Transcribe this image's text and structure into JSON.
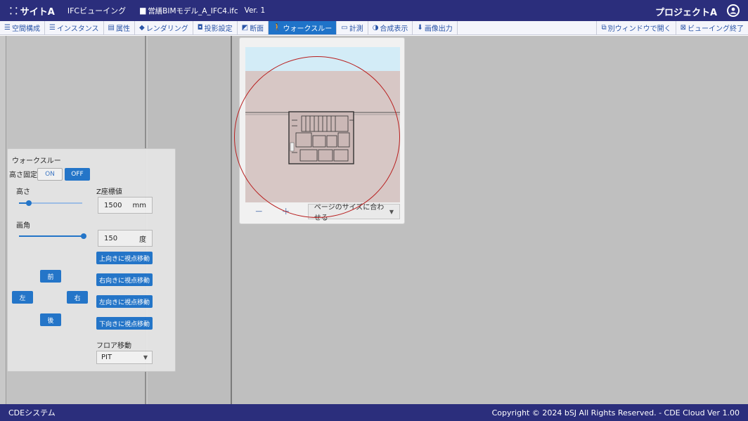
{
  "titlebar": {
    "site_label": "サイトA",
    "viewer_label": "IFCビューイング",
    "file_name": "営繕BIMモデル_A_IFC4.ifc",
    "version": "Ver. 1",
    "project": "プロジェクトA"
  },
  "toolbar": {
    "items": [
      {
        "icon": "list-icon",
        "glyph": "☰",
        "label": "空間構成"
      },
      {
        "icon": "list-icon",
        "glyph": "☰",
        "label": "インスタンス"
      },
      {
        "icon": "table-icon",
        "glyph": "▤",
        "label": "属性"
      },
      {
        "icon": "rendering-icon",
        "glyph": "◆",
        "label": "レンダリング"
      },
      {
        "icon": "camera-icon",
        "glyph": "◘",
        "label": "投影設定"
      },
      {
        "icon": "section-icon",
        "glyph": "◩",
        "label": "断面"
      },
      {
        "icon": "walk-icon",
        "glyph": "🚶",
        "label": "ウォークスルー",
        "active": true
      },
      {
        "icon": "measure-icon",
        "glyph": "▭",
        "label": "計測"
      },
      {
        "icon": "composite-icon",
        "glyph": "◑",
        "label": "合成表示"
      },
      {
        "icon": "download-icon",
        "glyph": "⬇",
        "label": "画像出力"
      }
    ],
    "right": [
      {
        "icon": "open-window-icon",
        "glyph": "⧉",
        "label": "別ウィンドウで開く"
      },
      {
        "icon": "close-view-icon",
        "glyph": "⊠",
        "label": "ビューイング終了"
      }
    ]
  },
  "walkthrough": {
    "title": "ウォークスルー",
    "height_fix_label": "高さ固定",
    "on_label": "ON",
    "off_label": "OFF",
    "height_label": "高さ",
    "z_label": "Z座標値",
    "z_value": "1500",
    "z_unit": "mm",
    "angle_label": "画角",
    "angle_value": "150",
    "angle_unit": "度",
    "height_slider_level": 0.15,
    "angle_slider_level": 1.0,
    "forward": "前",
    "left": "左",
    "right": "右",
    "back": "後",
    "view_up": "上向きに視点移動",
    "view_right": "右向きに視点移動",
    "view_left": "左向きに視点移動",
    "view_down": "下向きに視点移動",
    "floor_label": "フロア移動",
    "floor_value": "PIT"
  },
  "preview": {
    "zoom_out": "−",
    "zoom_in": "+",
    "fit_label": "ページのサイズに合わせる"
  },
  "footer": {
    "system": "CDEシステム",
    "copyright": "Copyright © 2024 bSJ All Rights Reserved. - CDE Cloud Ver 1.00"
  },
  "colors": {
    "header": "#2b2e7c",
    "accent": "#1f73c9",
    "annotation": "#b81e1e"
  }
}
